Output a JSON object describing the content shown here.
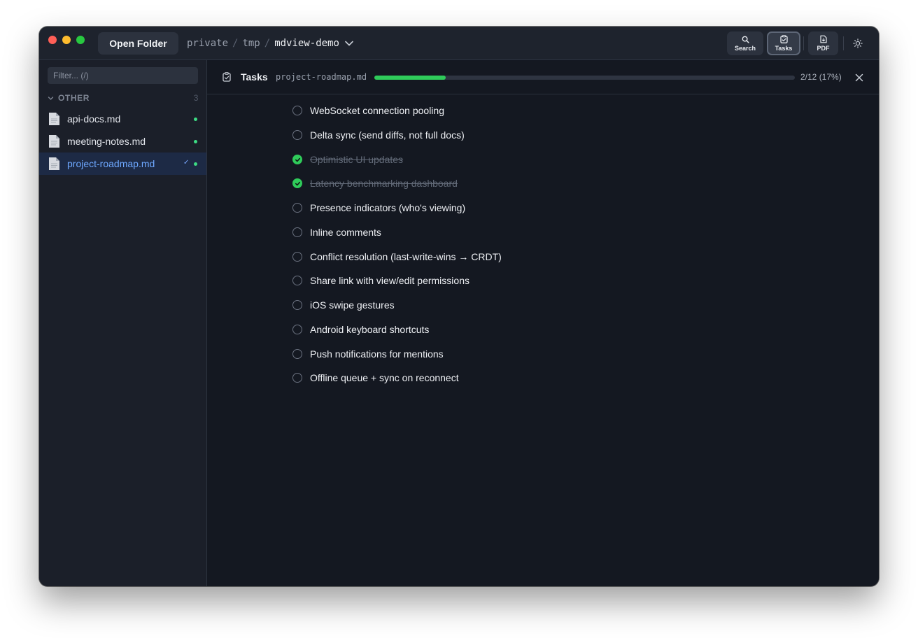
{
  "titlebar": {
    "open_folder": "Open Folder",
    "breadcrumb": [
      "private",
      "tmp",
      "mdview-demo"
    ],
    "separator": "/",
    "buttons": {
      "search": "Search",
      "tasks": "Tasks",
      "pdf": "PDF"
    }
  },
  "sidebar": {
    "filter_placeholder": "Filter... (/)",
    "section": {
      "label": "OTHER",
      "count": "3"
    },
    "files": [
      {
        "name": "api-docs.md",
        "active": false,
        "modified": true
      },
      {
        "name": "meeting-notes.md",
        "active": false,
        "modified": true
      },
      {
        "name": "project-roadmap.md",
        "active": true,
        "modified": true,
        "check": "✓"
      }
    ]
  },
  "tasks_panel": {
    "title": "Tasks",
    "file": "project-roadmap.md",
    "progress_fraction": 0.17,
    "progress_label": "2/12 (17%)",
    "items": [
      {
        "text": "WebSocket connection pooling",
        "done": false
      },
      {
        "text": "Delta sync (send diffs, not full docs)",
        "done": false
      },
      {
        "text": "Optimistic UI updates",
        "done": true
      },
      {
        "text": "Latency benchmarking dashboard",
        "done": true
      },
      {
        "text": "Presence indicators (who's viewing)",
        "done": false
      },
      {
        "text": "Inline comments",
        "done": false
      },
      {
        "text": "Conflict resolution (last-write-wins → CRDT)",
        "done": false
      },
      {
        "text": "Share link with view/edit permissions",
        "done": false
      },
      {
        "text": "iOS swipe gestures",
        "done": false
      },
      {
        "text": "Android keyboard shortcuts",
        "done": false
      },
      {
        "text": "Push notifications for mentions",
        "done": false
      },
      {
        "text": "Offline queue + sync on reconnect",
        "done": false
      }
    ]
  },
  "colors": {
    "accent_green": "#2fcb5a",
    "active_blue": "#6ea8ff",
    "background": "#141821"
  },
  "icons": [
    "search-icon",
    "tasks-icon",
    "pdf-icon",
    "sun-icon",
    "file-icon",
    "chevron-down-icon",
    "close-icon",
    "clipboard-check-icon",
    "checkmark-icon"
  ]
}
